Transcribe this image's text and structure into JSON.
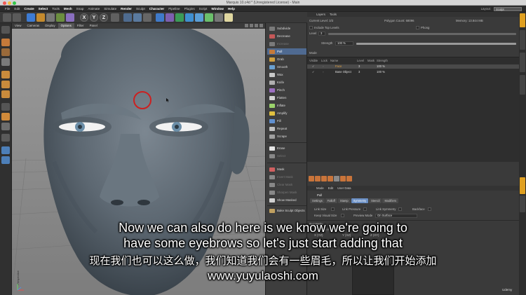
{
  "window": {
    "title": "Marquis 10.c4d * (Unregistered License) - Main"
  },
  "menubar": {
    "items": [
      "File",
      "Edit",
      "Create",
      "Select",
      "Tools",
      "Mesh",
      "Snap",
      "Animate",
      "Simulate",
      "Render",
      "Sculpt",
      "Character",
      "Pipeline",
      "Plugins",
      "Script",
      "Window",
      "Help"
    ],
    "layout_label": "Layout:",
    "layout_value": "Sculpt"
  },
  "toolbar": {
    "axis_buttons": [
      "X",
      "Y",
      "Z"
    ]
  },
  "viewport": {
    "menu": [
      "View",
      "Cameras",
      "Display",
      "Options",
      "Filter",
      "Panel"
    ],
    "camera_label": "Perspective"
  },
  "brushes": [
    {
      "label": "Subdivide",
      "dim": false
    },
    {
      "label": "Decrease",
      "dim": false
    },
    {
      "label": "Increase",
      "dim": true
    },
    {
      "label": "Pull",
      "selected": true
    },
    {
      "label": "Grab"
    },
    {
      "label": "Smooth"
    },
    {
      "label": "Wax"
    },
    {
      "label": "Knife"
    },
    {
      "label": "Pinch"
    },
    {
      "label": "Flatten"
    },
    {
      "label": "Inflate"
    },
    {
      "label": "Amplify"
    },
    {
      "label": "Fill"
    },
    {
      "label": "Repeat"
    },
    {
      "label": "Scrape"
    },
    {
      "label": "Erase"
    },
    {
      "label": "Select",
      "dim": true
    },
    {
      "label": "Mask"
    },
    {
      "label": "Invert Mask",
      "dim": true
    },
    {
      "label": "Clear Mask",
      "dim": true
    },
    {
      "label": "Sharpen Mask",
      "dim": true
    },
    {
      "label": "Show Masked"
    },
    {
      "label": "Bake Sculpt Objects"
    }
  ],
  "layers_panel": {
    "tabs": [
      "Layers",
      "Tools"
    ],
    "current_level": "Current Level: 3/3",
    "polygon_count": "Polygon Count: 68096",
    "memory": "Memory: 13.844 MB",
    "include_top_levels": "Include Top Levels",
    "phong": "Phong",
    "level_label": "Level",
    "level_value": "3",
    "strength_label": "Strength",
    "strength_value": "100 %",
    "strength_fraction": 1.0,
    "mode_label": "Mode",
    "columns": [
      "Visible",
      "Lock",
      "Name",
      "Level",
      "Mask",
      "Strength"
    ],
    "rows": [
      {
        "name": "Face",
        "level": "3",
        "strength": "100 %"
      },
      {
        "name": "Base Object",
        "level": "3",
        "strength": "100 %"
      }
    ]
  },
  "attributes": {
    "tabs": [
      "Mode",
      "Edit",
      "User Data"
    ],
    "object": "Pull",
    "subtabs": [
      "Settings",
      "Falloff",
      "Stamp",
      "Symmetry",
      "Stencil",
      "Modifiers"
    ],
    "selected_subtab": "Symmetry",
    "link_size": "Link Size",
    "link_pressure": "Link Pressure",
    "link_symmetry": "Link Symmetry",
    "backface": "Backface",
    "keep_visual_size": "Keep Visual Size",
    "preview_mode_label": "Preview Mode",
    "preview_mode_value": "On Surface",
    "symmetry_header": "Symmetry",
    "axis_label": "Axis",
    "axis_value": "Local",
    "x_label": "X (YZ)",
    "y_label": "Y (XZ)",
    "z_label": "Z (XY)"
  },
  "subtitles": {
    "line1": "Now we can also do here is we know we're going to",
    "line2": "have some eyebrows so let's just start adding that",
    "line3": "现在我们也可以这么做，我们知道我们会有一些眉毛，所以让我们开始添加",
    "watermark": "www.yuyulaoshi.com"
  },
  "branding": {
    "udemy": "Udemy"
  },
  "colors": {
    "accent": "#4f6a91",
    "brush_ring": "#cc2020",
    "sculpt_mesh": "#5d6872"
  }
}
